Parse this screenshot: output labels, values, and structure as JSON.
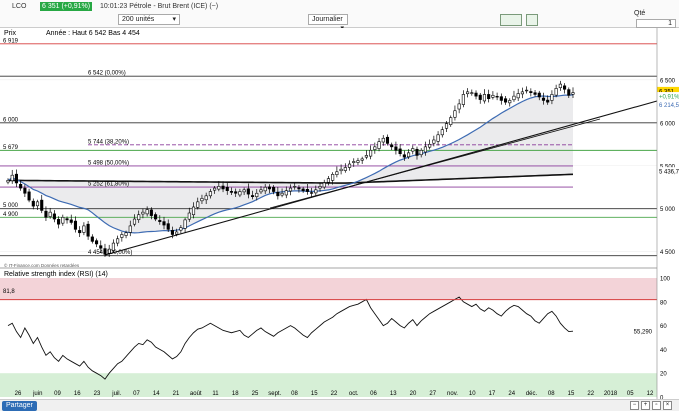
{
  "toolbar": {
    "title": "LCO",
    "last_price": "6 351 (+0,91%)",
    "title_rest": "10:01:23 Pétrole - Brut Brent (ICE) (~)",
    "units_select": "200 unités",
    "period_select": "Journalier",
    "qty_label": "Qté",
    "qty_value": "1"
  },
  "legend": {
    "price_label": "Prix",
    "year_label": "Année : Haut 6 542 Bas 4 454",
    "source": "© IT-Finance.com Données retardées",
    "rsi_label": "Relative strength index (RSI) (14)"
  },
  "left_labels": [
    "6 919",
    "6 000",
    "5 679",
    "5 000",
    "4 900"
  ],
  "fib_labels": [
    "6 542 (0,00%)",
    "5 744 (38,20%)",
    "5 498 (50,00%)",
    "5 252 (61,80%)",
    "4 454 (100,00%)"
  ],
  "rsi_left_label": "81,8",
  "right_axis": [
    "6 500",
    "6 000",
    "5 500",
    "5 000",
    "4 500"
  ],
  "right_badges": {
    "last": "6 351",
    "change": "+0,91%",
    "ma20": "6 214,5",
    "ma200": "5 436,7"
  },
  "rsi_axis": [
    "100",
    "80",
    "60",
    "40",
    "20",
    "0"
  ],
  "rsi_value_label": "55,290",
  "x_labels": [
    "26",
    "juin",
    "09",
    "16",
    "23",
    "juil.",
    "07",
    "14",
    "21",
    "août",
    "11",
    "18",
    "25",
    "sept.",
    "08",
    "15",
    "22",
    "oct.",
    "06",
    "13",
    "20",
    "27",
    "nov.",
    "10",
    "17",
    "24",
    "déc.",
    "08",
    "15",
    "22",
    "2018",
    "05",
    "12"
  ],
  "status": {
    "share_button": "Partager"
  },
  "colors": {
    "up_candle": "#ffffff",
    "down_candle": "#000000",
    "ma20": "#3d6bb3",
    "ma200": "#111111",
    "resistance_red": "#d63c3c",
    "support_green": "#4aa64a",
    "fib_purple": "#8a3a9a",
    "rsi_overbought_fill": "#f3d3d8",
    "rsi_oversold_fill": "#d6efd6",
    "badge_last": "#ffd700",
    "badge_change": "#2ea44f",
    "badge_ma20": "#3d6bb3"
  },
  "chart_data": {
    "type": "candlestick",
    "title": "Pétrole - Brut Brent (ICE)",
    "period": "Journalier",
    "price_range": [
      4380,
      6940
    ],
    "price_axis_ticks": [
      4500,
      5000,
      5500,
      6000,
      6500
    ],
    "year_high": 6542,
    "year_low": 4454,
    "last_price": 6351,
    "change_pct": 0.91,
    "horizontal_levels": [
      {
        "value": 6919,
        "color": "red"
      },
      {
        "value": 6542,
        "color": "black"
      },
      {
        "value": 6000,
        "color": "black"
      },
      {
        "value": 5679,
        "color": "green"
      },
      {
        "value": 5000,
        "color": "black"
      },
      {
        "value": 4900,
        "color": "green"
      },
      {
        "value": 4454,
        "color": "black"
      }
    ],
    "fibonacci": [
      {
        "pct": 0.0,
        "value": 6542
      },
      {
        "pct": 38.2,
        "value": 5744
      },
      {
        "pct": 50.0,
        "value": 5498
      },
      {
        "pct": 61.8,
        "value": 5252
      },
      {
        "pct": 100.0,
        "value": 4454
      }
    ],
    "moving_averages": [
      {
        "name": "MA20",
        "last": 6214.5
      },
      {
        "name": "MA200",
        "last": 5436.7
      }
    ],
    "closes": [
      5330,
      5390,
      5300,
      5240,
      5180,
      5100,
      5030,
      5080,
      4980,
      4900,
      4960,
      4880,
      4820,
      4900,
      4870,
      4840,
      4760,
      4720,
      4800,
      4680,
      4620,
      4590,
      4540,
      4470,
      4530,
      4600,
      4650,
      4700,
      4720,
      4800,
      4880,
      4930,
      4960,
      4990,
      4920,
      4880,
      4850,
      4810,
      4760,
      4700,
      4730,
      4780,
      4870,
      4950,
      5020,
      5080,
      5120,
      5150,
      5200,
      5240,
      5260,
      5230,
      5210,
      5190,
      5180,
      5200,
      5220,
      5170,
      5140,
      5180,
      5220,
      5250,
      5230,
      5200,
      5150,
      5180,
      5210,
      5240,
      5260,
      5230,
      5210,
      5200,
      5180,
      5220,
      5260,
      5300,
      5350,
      5400,
      5430,
      5460,
      5480,
      5520,
      5550,
      5560,
      5580,
      5620,
      5680,
      5720,
      5780,
      5820,
      5760,
      5720,
      5680,
      5640,
      5600,
      5650,
      5700,
      5620,
      5680,
      5720,
      5750,
      5800,
      5860,
      5920,
      5990,
      6060,
      6140,
      6220,
      6330,
      6360,
      6350,
      6310,
      6270,
      6330,
      6280,
      6320,
      6300,
      6260,
      6240,
      6260,
      6310,
      6340,
      6360,
      6380,
      6350,
      6330,
      6300,
      6260,
      6240,
      6330,
      6400,
      6450,
      6390,
      6320,
      6351
    ],
    "rsi": {
      "period": 14,
      "range": [
        0,
        100
      ],
      "overbought": 81.8,
      "last": 55.29,
      "values": [
        60,
        62,
        55,
        50,
        58,
        52,
        45,
        50,
        42,
        35,
        38,
        33,
        30,
        35,
        32,
        30,
        28,
        26,
        30,
        25,
        22,
        20,
        18,
        15,
        20,
        24,
        28,
        30,
        34,
        38,
        42,
        45,
        44,
        48,
        46,
        42,
        40,
        38,
        35,
        32,
        34,
        38,
        45,
        50,
        54,
        57,
        58,
        60,
        62,
        60,
        58,
        56,
        55,
        54,
        55,
        56,
        52,
        50,
        53,
        56,
        58,
        55,
        53,
        51,
        54,
        56,
        58,
        60,
        58,
        55,
        52,
        50,
        54,
        57,
        60,
        63,
        65,
        67,
        70,
        72,
        74,
        76,
        77,
        78,
        80,
        82,
        75,
        70,
        65,
        60,
        62,
        66,
        63,
        60,
        58,
        62,
        65,
        60,
        64,
        67,
        70,
        72,
        74,
        76,
        78,
        80,
        82,
        84,
        80,
        78,
        76,
        78,
        74,
        72,
        75,
        73,
        70,
        68,
        72,
        75,
        77,
        76,
        73,
        70,
        68,
        64,
        62,
        66,
        70,
        72,
        68,
        62,
        58,
        55,
        55.29
      ]
    },
    "x_range": [
      "2017-05-26",
      "2018-01-12"
    ]
  }
}
